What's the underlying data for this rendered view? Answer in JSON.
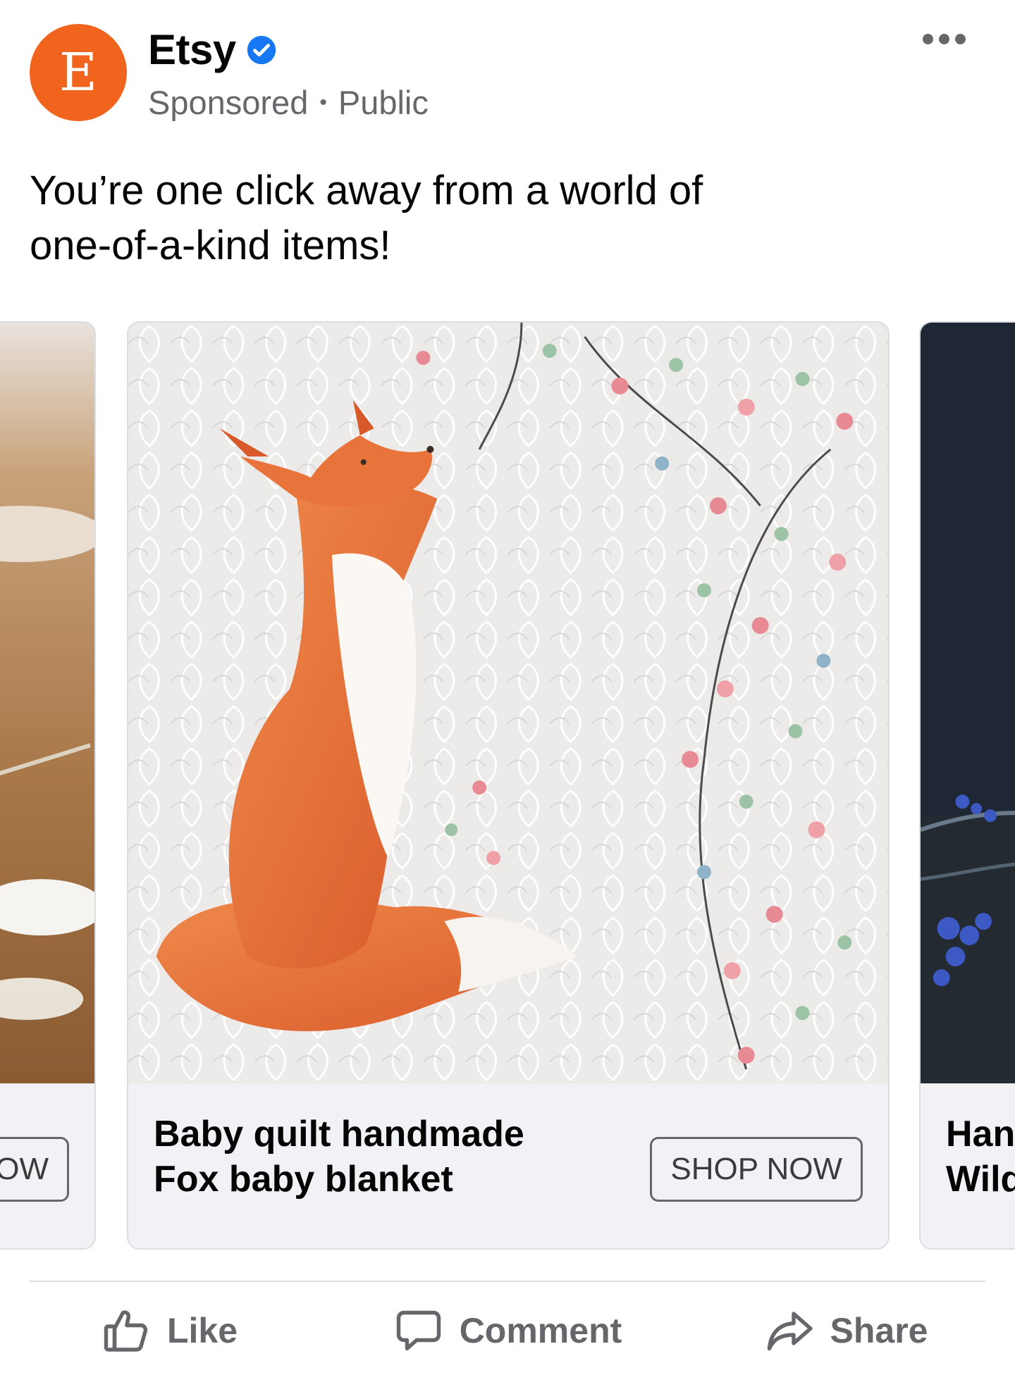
{
  "post": {
    "page_name": "Etsy",
    "avatar_letter": "E",
    "sponsored_label": "Sponsored",
    "separator": "•",
    "audience": "Public",
    "text_line1": "You’re one click away from a world of",
    "text_line2": "one-of-a-kind items!",
    "brand_color": "#f1641e",
    "verified_color": "#1877f2"
  },
  "carousel": {
    "left_card": {
      "cta": "SHOP NOW"
    },
    "main_card": {
      "title": "Baby quilt handmade Fox baby blanket",
      "cta": "SHOP NOW"
    },
    "right_card": {
      "title": "Handmade Wild"
    }
  },
  "actions": {
    "like": "Like",
    "comment": "Comment",
    "share": "Share"
  }
}
